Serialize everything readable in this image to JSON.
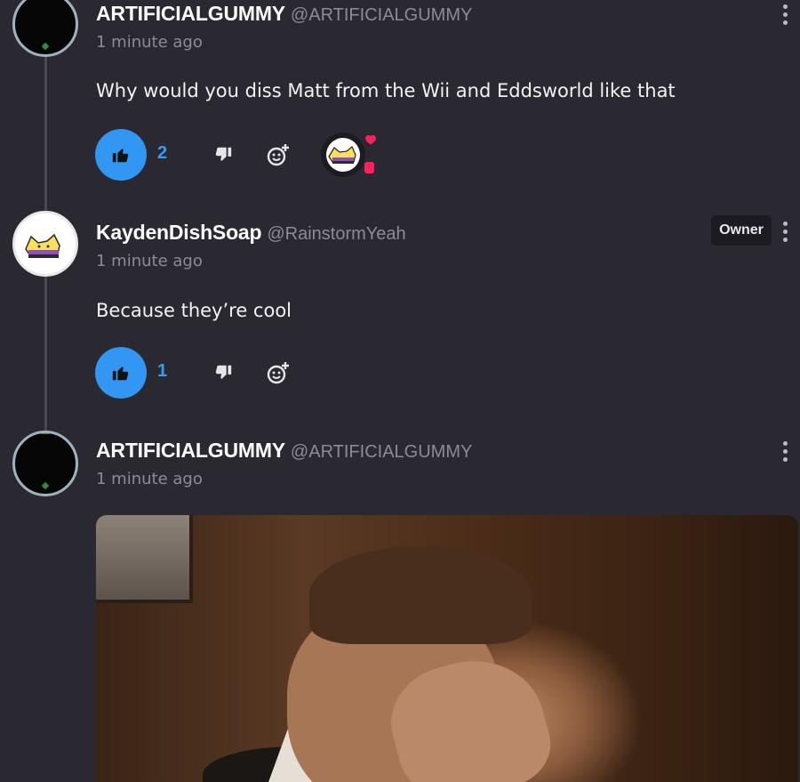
{
  "comments": [
    {
      "author": "ARTIFICIALGUMMY",
      "handle": "@ARTIFICIALGUMMY",
      "time": "1 minute ago",
      "text": "Why would you diss Matt from the Wii and Eddsworld like that",
      "likes": "2",
      "creator_hearted": true
    },
    {
      "author": "KaydenDishSoap",
      "handle": "@RainstormYeah",
      "badge": "Owner",
      "time": "1 minute ago",
      "text": "Because they’re cool",
      "likes": "1"
    },
    {
      "author": "ARTIFICIALGUMMY",
      "handle": "@ARTIFICIALGUMMY",
      "time": "1 minute ago",
      "has_image": true
    }
  ],
  "icons": {
    "like": "thumbs-up-icon",
    "dislike": "thumbs-down-icon",
    "react": "add-reaction-icon",
    "menu": "more-vertical-icon"
  },
  "colors": {
    "background": "#2a2932",
    "accent": "#3296f3",
    "muted_text": "#8c8b95",
    "heart": "#ff1f5a"
  }
}
